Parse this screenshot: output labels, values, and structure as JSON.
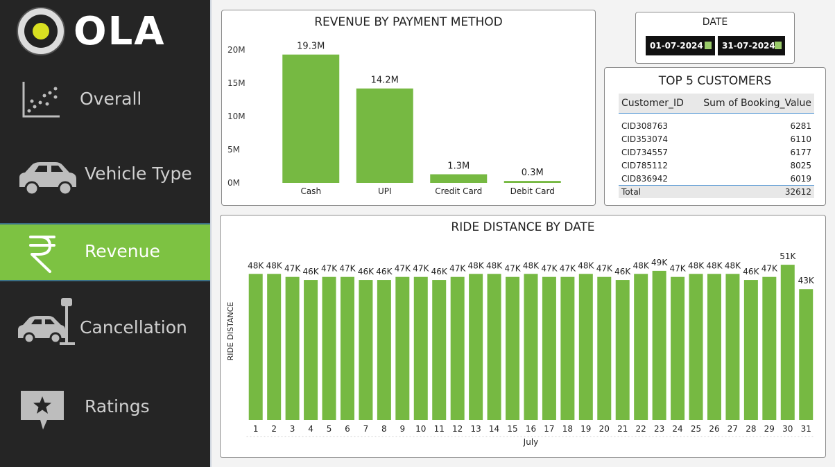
{
  "brand": {
    "name": "OLA"
  },
  "nav": [
    {
      "label": "Overall",
      "icon": "scatter-chart-icon",
      "active": false
    },
    {
      "label": "Vehicle Type",
      "icon": "car-icon",
      "active": false
    },
    {
      "label": "Revenue",
      "icon": "rupee-icon",
      "active": true
    },
    {
      "label": "Cancellation",
      "icon": "car-crash-icon",
      "active": false
    },
    {
      "label": "Ratings",
      "icon": "star-comment-icon",
      "active": false
    }
  ],
  "colors": {
    "sidebar": "#252525",
    "accent": "#7dc242",
    "bar": "#76b942"
  },
  "date_filter": {
    "title": "DATE",
    "start": "01-07-2024",
    "end": "31-07-2024"
  },
  "top_customers": {
    "title": "TOP 5 CUSTOMERS",
    "headers": [
      "Customer_ID",
      "Sum of Booking_Value"
    ],
    "rows": [
      [
        "CID308763",
        "6281"
      ],
      [
        "CID353074",
        "6110"
      ],
      [
        "CID734557",
        "6177"
      ],
      [
        "CID785112",
        "8025"
      ],
      [
        "CID836942",
        "6019"
      ]
    ],
    "total": [
      "Total",
      "32612"
    ]
  },
  "chart_data": [
    {
      "type": "bar",
      "title": "REVENUE BY PAYMENT METHOD",
      "categories": [
        "Cash",
        "UPI",
        "Credit Card",
        "Debit Card"
      ],
      "values": [
        19.3,
        14.2,
        1.3,
        0.3
      ],
      "value_labels": [
        "19.3M",
        "14.2M",
        "1.3M",
        "0.3M"
      ],
      "ylim": [
        0,
        20
      ],
      "yticks": [
        "0M",
        "5M",
        "10M",
        "15M",
        "20M"
      ],
      "grid": false
    },
    {
      "type": "bar",
      "title": "RIDE DISTANCE BY DATE",
      "xlabel": "July",
      "ylabel": "RIDE DISTANCE",
      "categories": [
        "1",
        "2",
        "3",
        "4",
        "5",
        "6",
        "7",
        "8",
        "9",
        "10",
        "11",
        "12",
        "13",
        "14",
        "15",
        "16",
        "17",
        "18",
        "19",
        "20",
        "21",
        "22",
        "23",
        "24",
        "25",
        "26",
        "27",
        "28",
        "29",
        "30",
        "31"
      ],
      "values": [
        48,
        48,
        47,
        46,
        47,
        47,
        46,
        46,
        47,
        47,
        46,
        47,
        48,
        48,
        47,
        48,
        47,
        47,
        48,
        47,
        46,
        48,
        49,
        47,
        48,
        48,
        48,
        46,
        47,
        51,
        43
      ],
      "value_labels": [
        "48K",
        "48K",
        "47K",
        "46K",
        "47K",
        "47K",
        "46K",
        "46K",
        "47K",
        "47K",
        "46K",
        "47K",
        "48K",
        "48K",
        "47K",
        "48K",
        "47K",
        "47K",
        "48K",
        "47K",
        "46K",
        "48K",
        "49K",
        "47K",
        "48K",
        "48K",
        "48K",
        "46K",
        "47K",
        "51K",
        "43K"
      ],
      "grid": false
    }
  ]
}
